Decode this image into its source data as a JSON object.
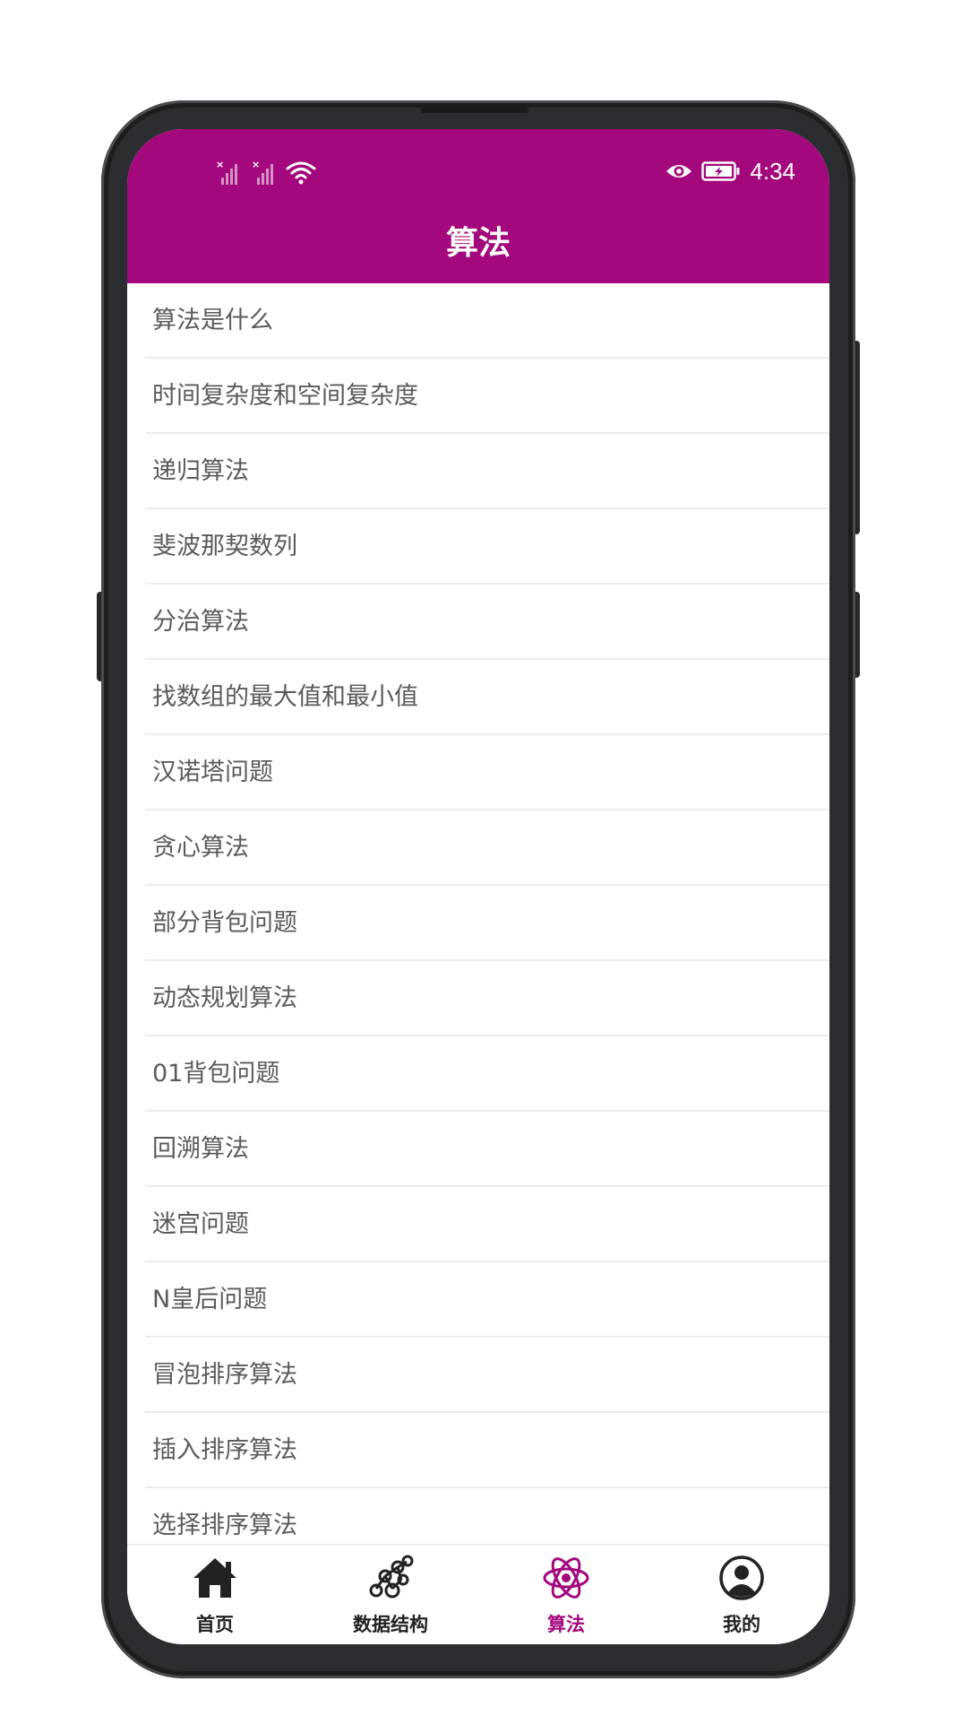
{
  "status_bar": {
    "time": "4:34",
    "icons": [
      "signal-1-icon",
      "signal-2-icon",
      "wifi-icon",
      "eye-icon",
      "battery-icon"
    ]
  },
  "header": {
    "title": "算法"
  },
  "list": {
    "items": [
      {
        "label": "算法是什么"
      },
      {
        "label": "时间复杂度和空间复杂度"
      },
      {
        "label": "递归算法"
      },
      {
        "label": "斐波那契数列"
      },
      {
        "label": "分治算法"
      },
      {
        "label": "找数组的最大值和最小值"
      },
      {
        "label": "汉诺塔问题"
      },
      {
        "label": "贪心算法"
      },
      {
        "label": "部分背包问题"
      },
      {
        "label": "动态规划算法"
      },
      {
        "label": "01背包问题"
      },
      {
        "label": "回溯算法"
      },
      {
        "label": "迷宫问题"
      },
      {
        "label": "N皇后问题"
      },
      {
        "label": "冒泡排序算法"
      },
      {
        "label": "插入排序算法"
      },
      {
        "label": "选择排序算法"
      }
    ]
  },
  "tabbar": {
    "tabs": [
      {
        "label": "首页",
        "icon": "home-icon",
        "active": false
      },
      {
        "label": "数据结构",
        "icon": "data-structure-icon",
        "active": false
      },
      {
        "label": "算法",
        "icon": "atom-icon",
        "active": true
      },
      {
        "label": "我的",
        "icon": "profile-icon",
        "active": false
      }
    ]
  },
  "colors": {
    "accent": "#a3097c",
    "text": "#5a5a5a",
    "divider": "#ececec"
  }
}
